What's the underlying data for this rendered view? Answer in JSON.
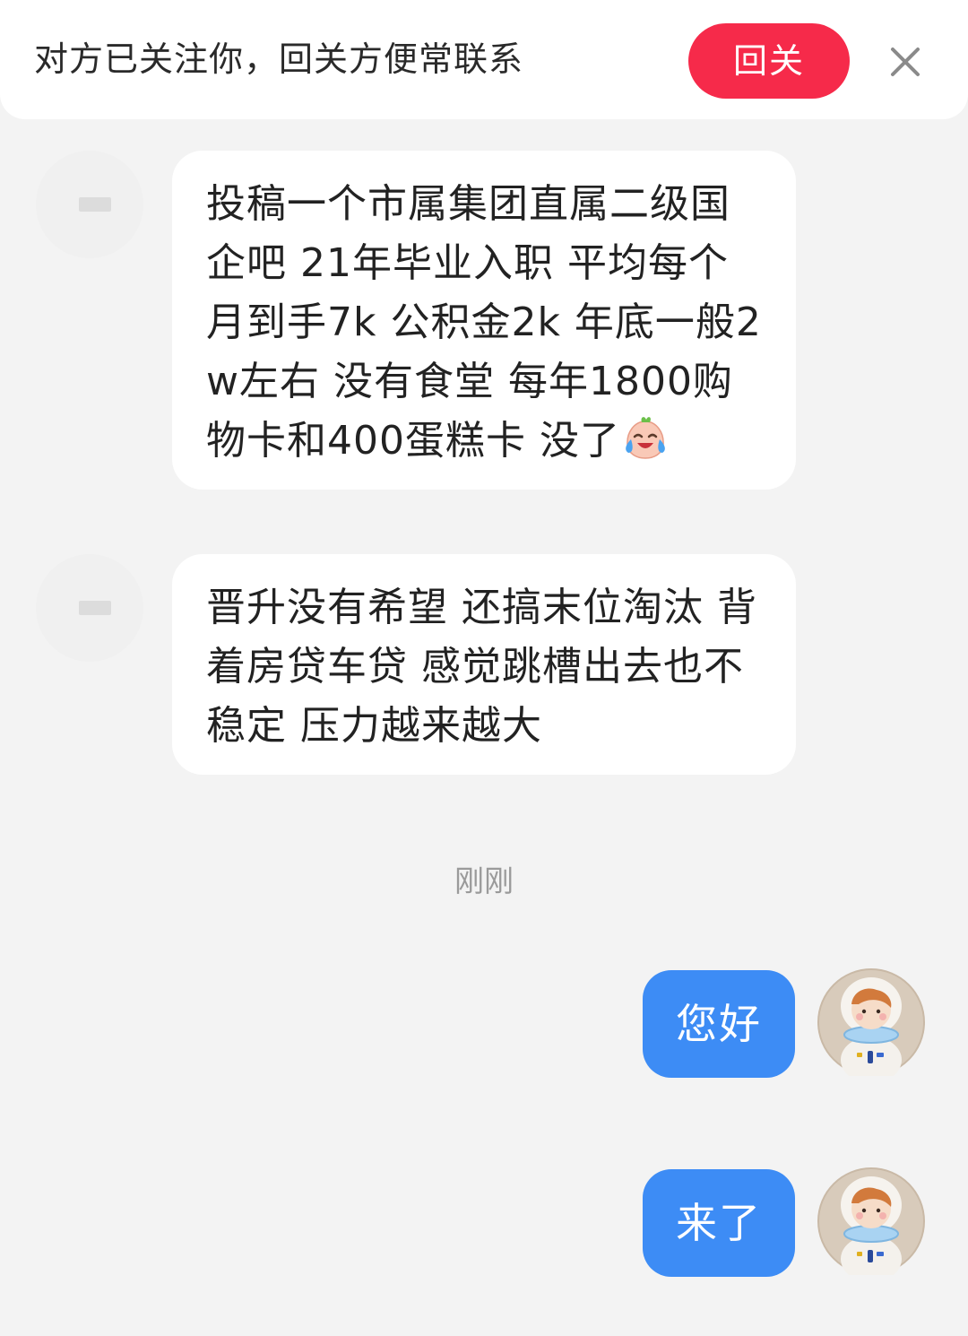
{
  "follow_banner": {
    "text": "对方已关注你，回关方便常联系",
    "button_label": "回关"
  },
  "messages_in": [
    {
      "text": "投稿一个市属集团直属二级国企吧 21年毕业入职 平均每个月到手7k 公积金2k 年底一般2w左右 没有食堂 每年1800购物卡和400蛋糕卡 没了",
      "emoji": "crying-laughing-emoji"
    },
    {
      "text": "晋升没有希望 还搞末位淘汰 背着房贷车贷 感觉跳槽出去也不稳定 压力越来越大"
    }
  ],
  "timestamp": "刚刚",
  "messages_out": [
    {
      "text": "您好"
    },
    {
      "text": "来了"
    }
  ],
  "colors": {
    "follow_button": "#f62a4a",
    "outgoing_bubble": "#3d8cf5",
    "background": "#f3f3f3"
  }
}
